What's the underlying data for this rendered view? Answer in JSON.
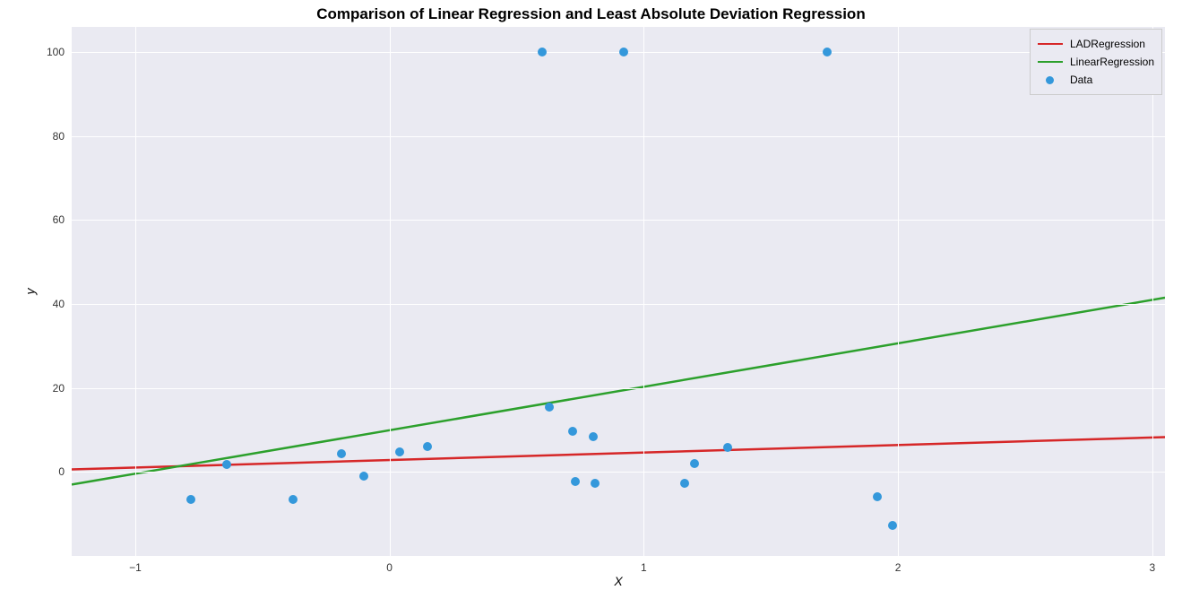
{
  "chart_data": {
    "type": "scatter",
    "title": "Comparison of Linear Regression and Least Absolute Deviation Regression",
    "xlabel": "X",
    "ylabel": "y",
    "xlim": [
      -1.25,
      3.05
    ],
    "ylim": [
      -20,
      106
    ],
    "xticks": [
      -1,
      0,
      1,
      2,
      3
    ],
    "yticks": [
      0,
      20,
      40,
      60,
      80,
      100
    ],
    "scatter": {
      "name": "Data",
      "color": "#3498db",
      "points": [
        {
          "x": -0.78,
          "y": -6.5
        },
        {
          "x": -0.64,
          "y": 1.8
        },
        {
          "x": -0.38,
          "y": -6.5
        },
        {
          "x": -0.19,
          "y": 4.4
        },
        {
          "x": -0.1,
          "y": -1.0
        },
        {
          "x": 0.04,
          "y": 4.7
        },
        {
          "x": 0.15,
          "y": 6.0
        },
        {
          "x": 0.6,
          "y": 100
        },
        {
          "x": 0.63,
          "y": 15.5
        },
        {
          "x": 0.72,
          "y": 9.7
        },
        {
          "x": 0.73,
          "y": -2.2
        },
        {
          "x": 0.8,
          "y": 8.4
        },
        {
          "x": 0.81,
          "y": -2.7
        },
        {
          "x": 0.92,
          "y": 100
        },
        {
          "x": 1.16,
          "y": -2.7
        },
        {
          "x": 1.2,
          "y": 2.0
        },
        {
          "x": 1.33,
          "y": 5.9
        },
        {
          "x": 1.72,
          "y": 100
        },
        {
          "x": 1.92,
          "y": -6.0
        },
        {
          "x": 1.98,
          "y": -12.7
        }
      ]
    },
    "lines": [
      {
        "name": "LADRegression",
        "color": "#d62728",
        "x": [
          -1.25,
          3.05
        ],
        "y": [
          0.6,
          8.3
        ]
      },
      {
        "name": "LinearRegression",
        "color": "#2ca02c",
        "x": [
          -1.25,
          3.05
        ],
        "y": [
          -3.0,
          41.5
        ]
      }
    ],
    "legend": {
      "items": [
        {
          "type": "line",
          "label": "LADRegression",
          "color": "#d62728"
        },
        {
          "type": "line",
          "label": "LinearRegression",
          "color": "#2ca02c"
        },
        {
          "type": "marker",
          "label": "Data",
          "color": "#3498db"
        }
      ]
    }
  }
}
